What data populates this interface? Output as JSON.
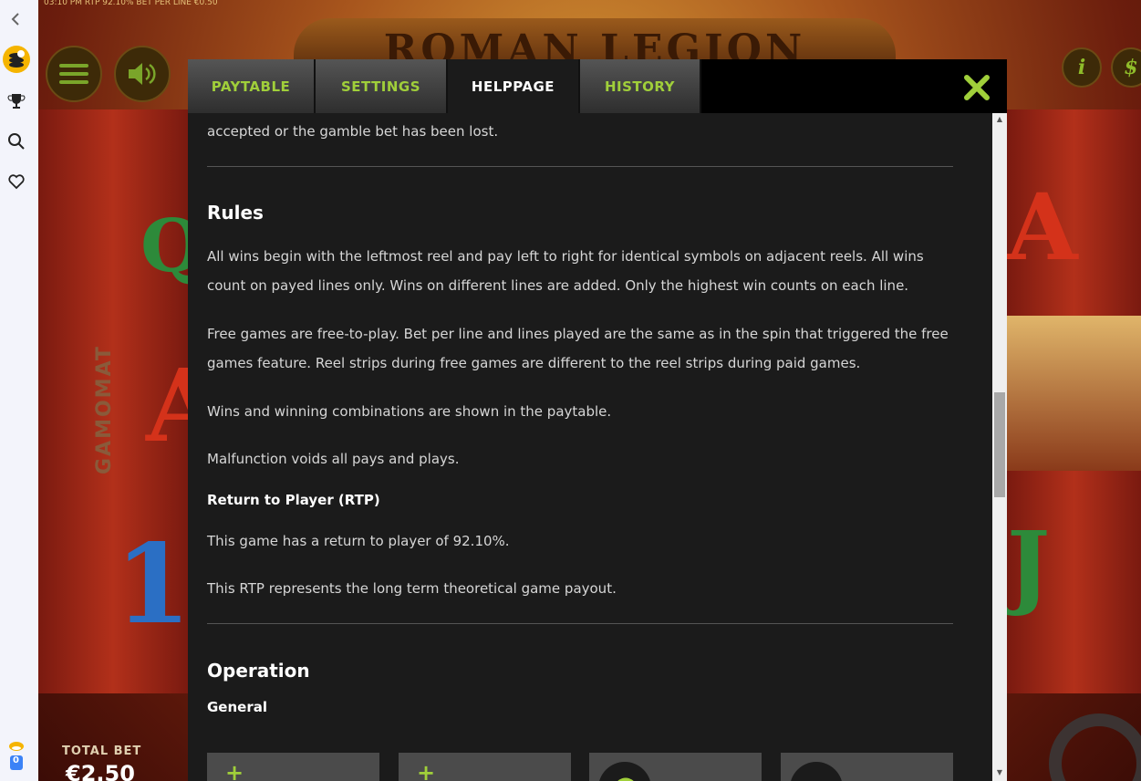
{
  "status_line": "03:10 PM  RTP 92.10%  BET PER LINE €0.50",
  "game_logo": "ROMAN LEGION",
  "provider_vertical": "GAMOMAT",
  "bottom": {
    "total_bet_label": "TOTAL BET",
    "total_bet_value": "€2.50"
  },
  "rail": {
    "bonus_count": "0"
  },
  "buttons": {
    "info": "i",
    "currency": "$"
  },
  "tabs": [
    {
      "label": "PAYTABLE",
      "active": false
    },
    {
      "label": "SETTINGS",
      "active": false
    },
    {
      "label": "HELPPAGE",
      "active": true
    },
    {
      "label": "HISTORY",
      "active": false
    }
  ],
  "help": {
    "prev_tail": "accepted or the gamble bet has been lost.",
    "rules_heading": "Rules",
    "rules_p1": "All wins begin with the leftmost reel and pay left to right for identical symbols on adjacent reels. All wins count on payed lines only. Wins on different lines are added. Only the highest win counts on each line.",
    "rules_p2": "Free games are free-to-play. Bet per line and lines played are the same as in the spin that triggered the free games feature. Reel strips during free games are different to the reel strips during paid games.",
    "rules_p3": "Wins and winning combinations are shown in the paytable.",
    "rules_p4": "Malfunction voids all pays and plays.",
    "rtp_heading": "Return to Player (RTP)",
    "rtp_p1": "This game has a return to player of 92.10%.",
    "rtp_p2": "This RTP represents the long term theoretical game payout.",
    "operation_heading": "Operation",
    "general_heading": "General"
  },
  "colors": {
    "accent_green": "#a0cf3a",
    "modal_bg": "#1b1b1b",
    "tab_bg": "#3a3a3a"
  },
  "icons": [
    "back-chevron-icon",
    "coins-icon",
    "trophy-icon",
    "search-icon",
    "heart-icon",
    "bonus-icon",
    "menu-icon",
    "speaker-icon",
    "info-icon",
    "dollar-icon",
    "close-icon",
    "plus-icon",
    "refresh-icon"
  ]
}
